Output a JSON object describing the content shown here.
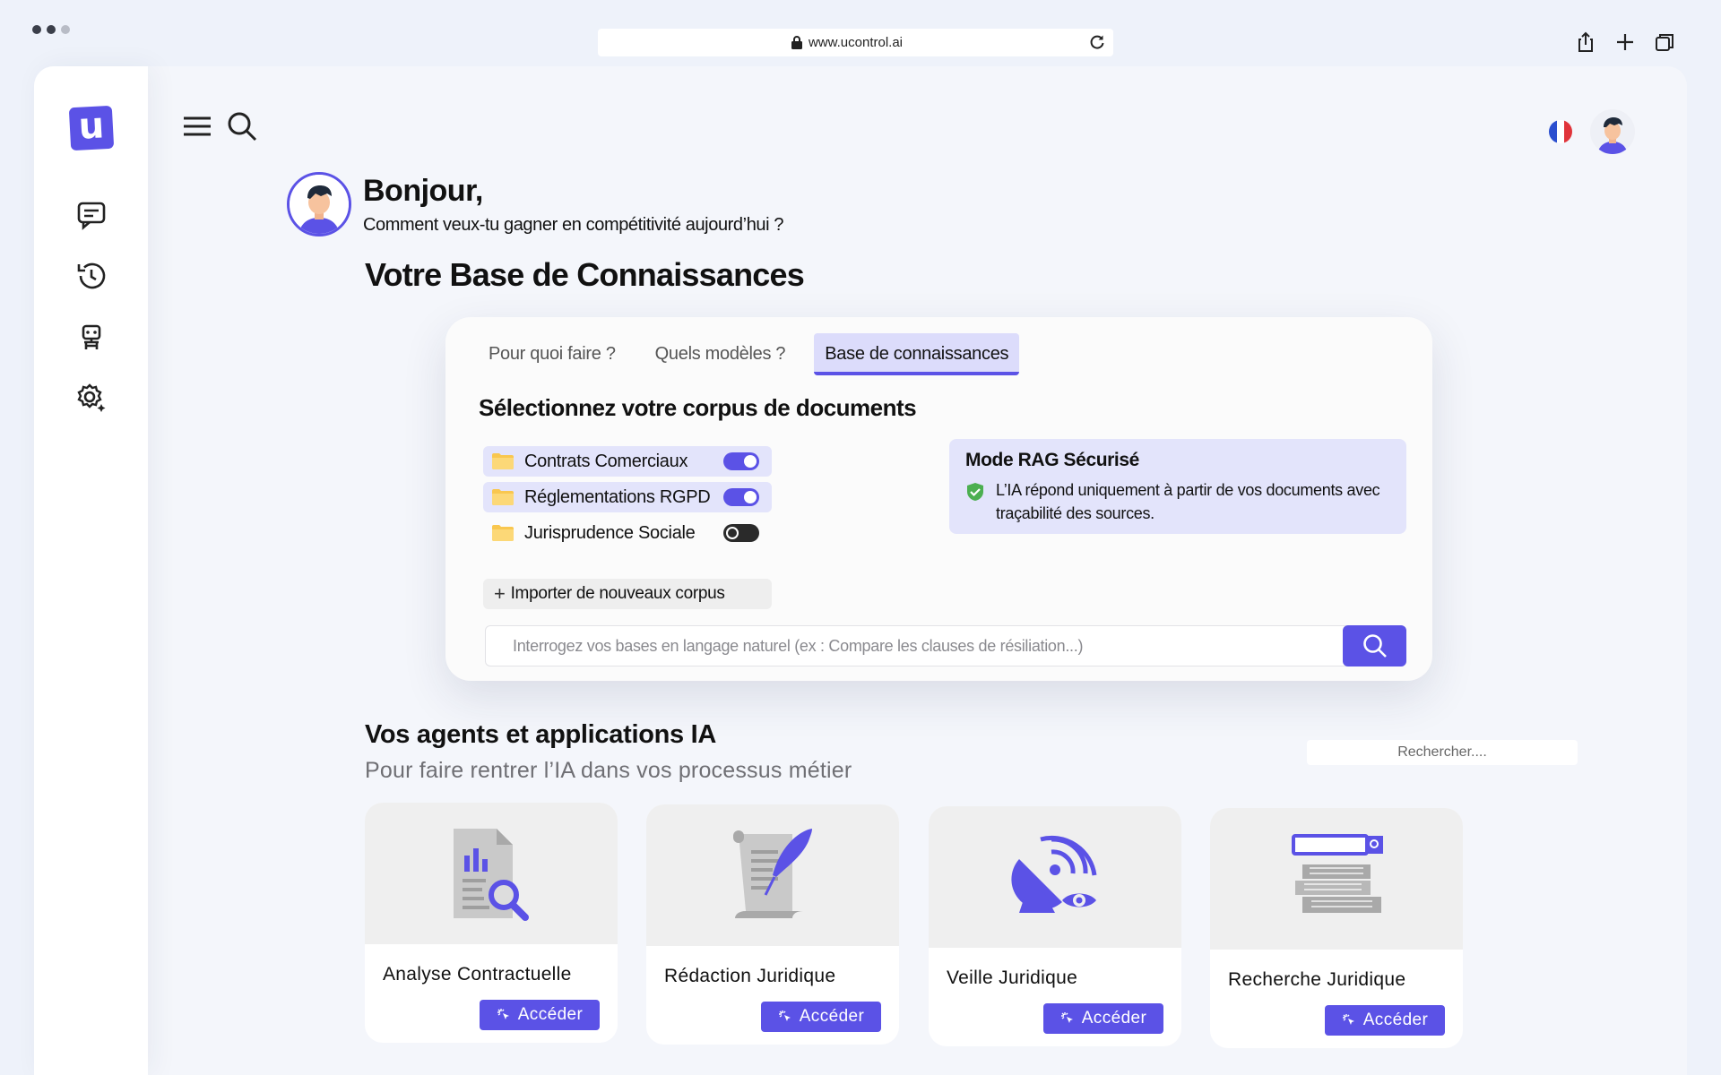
{
  "browser": {
    "url": "www.ucontrol.ai"
  },
  "app": {
    "logo_letter": "u",
    "brand_color": "#5b52e6",
    "sidebar": [
      {
        "icon": "chat-icon"
      },
      {
        "icon": "history-icon"
      },
      {
        "icon": "robot-icon"
      },
      {
        "icon": "settings-icon"
      }
    ]
  },
  "greeting": {
    "title": "Bonjour,",
    "subtitle": "Comment veux-tu gagner en compétitivité aujourd’hui ?"
  },
  "knowledge_base": {
    "title": "Votre Base de Connaissances",
    "tabs": [
      {
        "label": "Pour quoi faire ?",
        "active": false
      },
      {
        "label": "Quels modèles ?",
        "active": false
      },
      {
        "label": "Base de connaissances",
        "active": true
      }
    ],
    "select_title": "Sélectionnez votre corpus de documents",
    "corpora": [
      {
        "label": "Contrats Comerciaux",
        "enabled": true
      },
      {
        "label": "Réglementations RGPD",
        "enabled": true
      },
      {
        "label": "Jurisprudence Sociale",
        "enabled": false
      }
    ],
    "import_label": "Importer de nouveaux corpus",
    "rag": {
      "title": "Mode RAG Sécurisé",
      "text": "L’IA répond uniquement à partir de vos documents avec traçabilité des sources."
    },
    "query_placeholder": "Interrogez vos bases en langage naturel (ex : Compare les clauses de résiliation...)"
  },
  "agents": {
    "title": "Vos agents et applications IA",
    "subtitle": "Pour faire rentrer l’IA dans vos processus métier",
    "search_placeholder": "Rechercher....",
    "cards": [
      {
        "name": "Analyse Contractuelle",
        "button": "Accéder",
        "icon": "document-analysis-icon"
      },
      {
        "name": "Rédaction Juridique",
        "button": "Accéder",
        "icon": "scroll-quill-icon"
      },
      {
        "name": "Veille Juridique",
        "button": "Accéder",
        "icon": "satellite-watch-icon"
      },
      {
        "name": "Recherche Juridique",
        "button": "Accéder",
        "icon": "books-search-icon"
      }
    ]
  }
}
